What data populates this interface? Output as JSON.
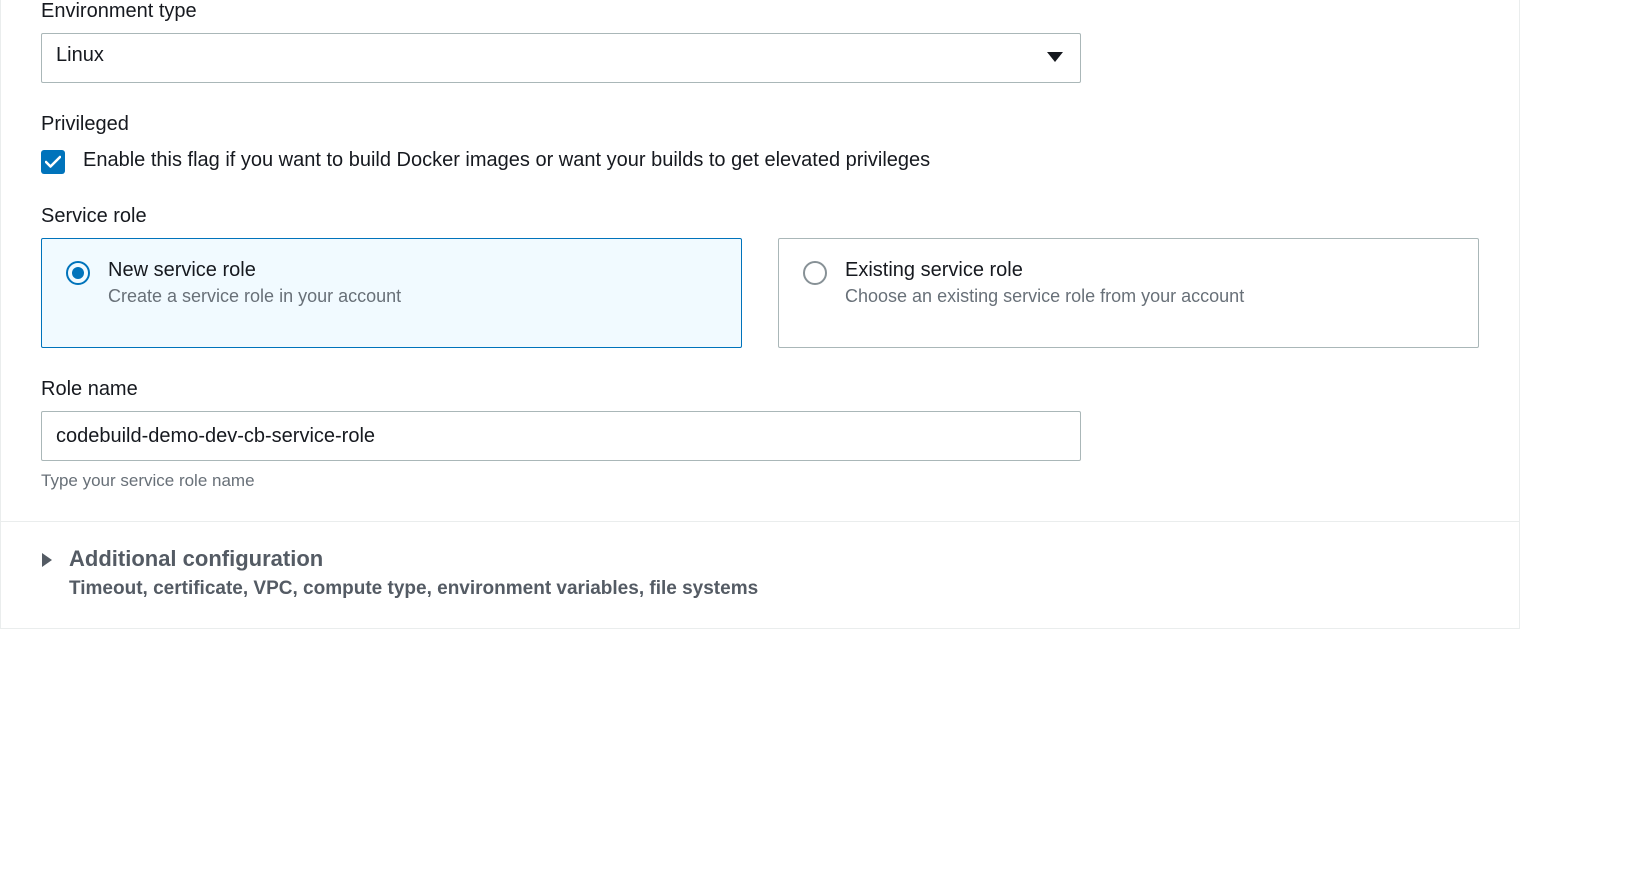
{
  "environment": {
    "type_label": "Environment type",
    "type_value": "Linux"
  },
  "privileged": {
    "label": "Privileged",
    "checkbox_label": "Enable this flag if you want to build Docker images or want your builds to get elevated privileges",
    "checked": true
  },
  "service_role": {
    "label": "Service role",
    "options": [
      {
        "title": "New service role",
        "description": "Create a service role in your account",
        "selected": true
      },
      {
        "title": "Existing service role",
        "description": "Choose an existing service role from your account",
        "selected": false
      }
    ]
  },
  "role_name": {
    "label": "Role name",
    "value": "codebuild-demo-dev-cb-service-role",
    "helper": "Type your service role name"
  },
  "additional": {
    "title": "Additional configuration",
    "description": "Timeout, certificate, VPC, compute type, environment variables, file systems"
  }
}
